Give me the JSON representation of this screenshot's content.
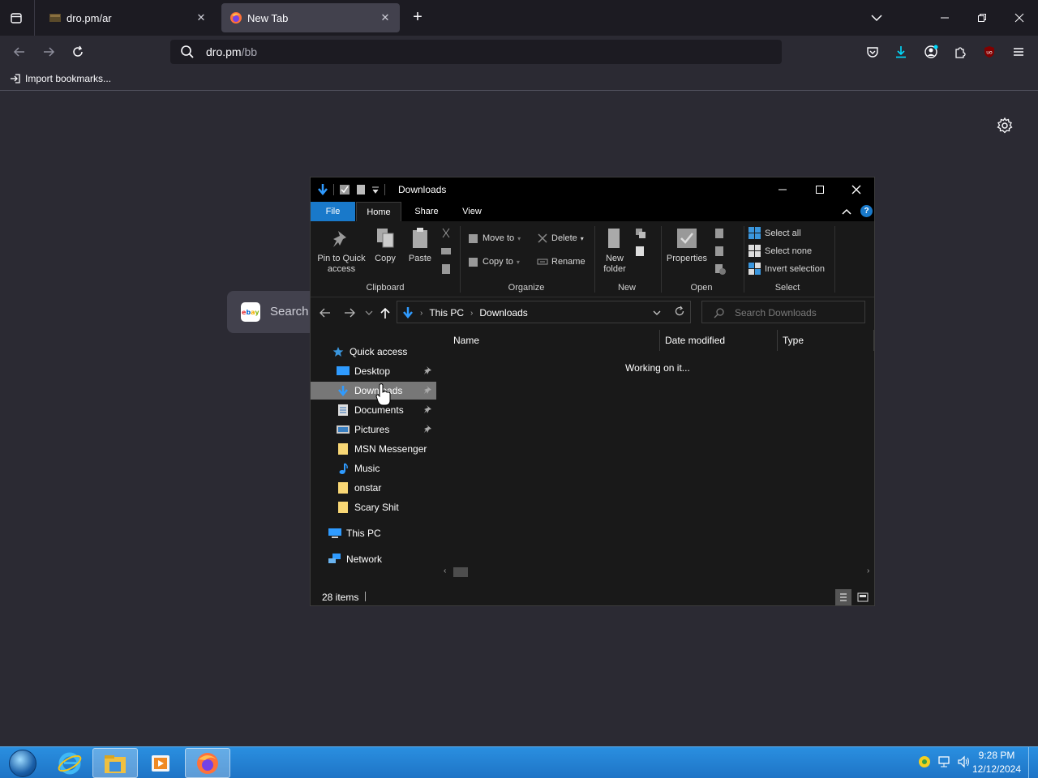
{
  "browser": {
    "tabs": [
      {
        "title": "dro.pm/ar",
        "close": "✕"
      },
      {
        "title": "New Tab",
        "close": "✕"
      }
    ],
    "new_tab": "+",
    "url_host": "dro.pm",
    "url_path": "/bb",
    "bookmark_import": "Import bookmarks...",
    "search_card_label": "Search"
  },
  "explorer": {
    "title": "Downloads",
    "tabs": [
      "File",
      "Home",
      "Share",
      "View"
    ],
    "help": "?",
    "ribbon": {
      "pin": "Pin to Quick access",
      "copy": "Copy",
      "paste": "Paste",
      "move_to": "Move to",
      "copy_to": "Copy to",
      "delete": "Delete",
      "rename": "Rename",
      "new_folder": "New folder",
      "properties": "Properties",
      "select_all": "Select all",
      "select_none": "Select none",
      "invert_selection": "Invert selection",
      "groups": [
        "Clipboard",
        "Organize",
        "New",
        "Open",
        "Select"
      ]
    },
    "address": {
      "crumbs": [
        "This PC",
        "Downloads"
      ],
      "search_placeholder": "Search Downloads"
    },
    "nav": {
      "quick_access": "Quick access",
      "items": [
        "Desktop",
        "Downloads",
        "Documents",
        "Pictures",
        "MSN Messenger",
        "Music",
        "onstar",
        "Scary Shit"
      ],
      "this_pc": "This PC",
      "network": "Network"
    },
    "columns": [
      "Name",
      "Date modified",
      "Type"
    ],
    "status_message": "Working on it...",
    "item_count": "28 items"
  },
  "taskbar": {
    "time": "9:28 PM",
    "date": "12/12/2024"
  },
  "colors": {
    "browser_bg": "#2b2a33",
    "tabbar_bg": "#1c1b22",
    "explorer_bg": "#191919",
    "file_tab": "#1979ca",
    "taskbar": "#1e74c6"
  }
}
